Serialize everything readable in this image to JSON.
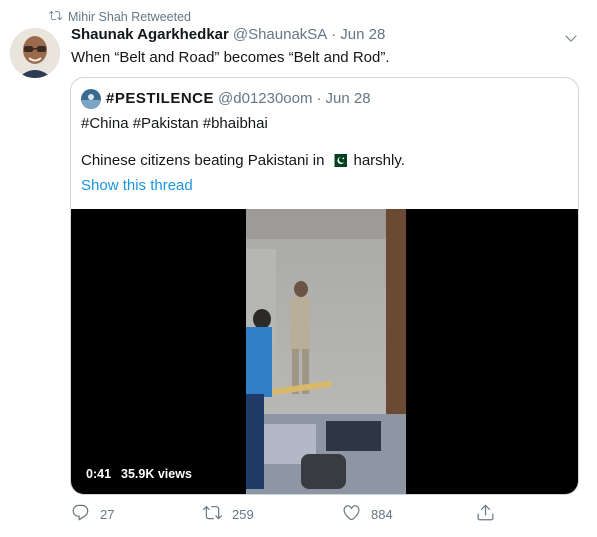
{
  "retweet": {
    "icon": "retweet-icon",
    "label": "Mihir Shah Retweeted"
  },
  "tweet": {
    "author_name": "Shaunak Agarkhedkar",
    "author_handle": "@ShaunakSA",
    "separator": "·",
    "time": "Jun 28",
    "text": "When “Belt and Road” becomes “Belt and Rod”."
  },
  "quote": {
    "author_name": "#PESTILENCE",
    "author_handle": "@d01230oom",
    "separator": "·",
    "time": "Jun 28",
    "line1": "#China #Pakistan #bhaibhai",
    "line2_before": "Chinese citizens beating Pakistani in",
    "line2_after": "harshly.",
    "show_thread": "Show this thread",
    "video": {
      "duration": "0:41",
      "views": "35.9K views"
    }
  },
  "actions": {
    "reply_count": "27",
    "retweet_count": "259",
    "like_count": "884"
  },
  "colors": {
    "link": "#1b95e0",
    "muted": "#657786",
    "border": "#ccd6dd"
  }
}
